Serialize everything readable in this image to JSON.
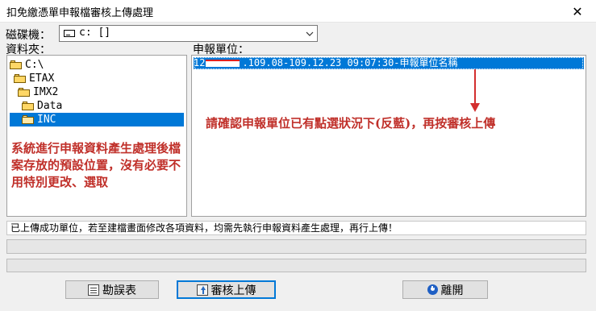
{
  "window": {
    "title": "扣免繳憑單申報檔審核上傳處理",
    "close_glyph": "✕"
  },
  "drive": {
    "label": "磁碟機：",
    "value": "c: []",
    "icon": "drive-icon"
  },
  "folders": {
    "label": "資料夾：",
    "items": [
      "C:\\",
      "ETAX",
      "IMX2",
      "Data",
      "INC"
    ],
    "selected": "INC"
  },
  "units": {
    "label": "申報單位：",
    "rows": [
      {
        "prefix": "12",
        "text": ".109.08-109.12.23 09:07:30-申報單位名稱",
        "selected": true
      }
    ]
  },
  "annotations": {
    "left": "系統進行申報資料產生處理後檔案存放的預設位置，沒有必要不用特別更改、選取",
    "right": "請確認申報單位已有點選狀況下(反藍)，再按審核上傳",
    "color": "#c0302a"
  },
  "status": {
    "message": "已上傳成功單位，若至建檔畫面修改各項資料，均需先執行申報資料產生處理，再行上傳！"
  },
  "buttons": {
    "errors_label": "勘誤表",
    "upload_label": "審核上傳",
    "exit_label": "離開"
  },
  "colors": {
    "selection": "#0078d7",
    "focus": "#0078d7"
  }
}
